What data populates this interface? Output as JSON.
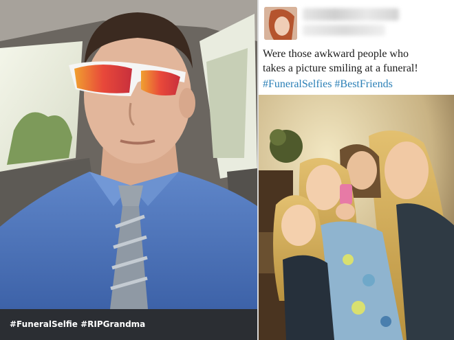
{
  "left_panel": {
    "caption": "#FuneralSelfie #RIPGrandma"
  },
  "tweet": {
    "text_line_1": "Were those awkward people who",
    "text_line_2": "takes a  picture smiling at a funeral!",
    "hashtags": [
      "#FuneralSelfies",
      "#BestFriends"
    ]
  },
  "colors": {
    "hashtag_blue": "#2a7fb6",
    "caption_bar": "#2b2e33"
  }
}
